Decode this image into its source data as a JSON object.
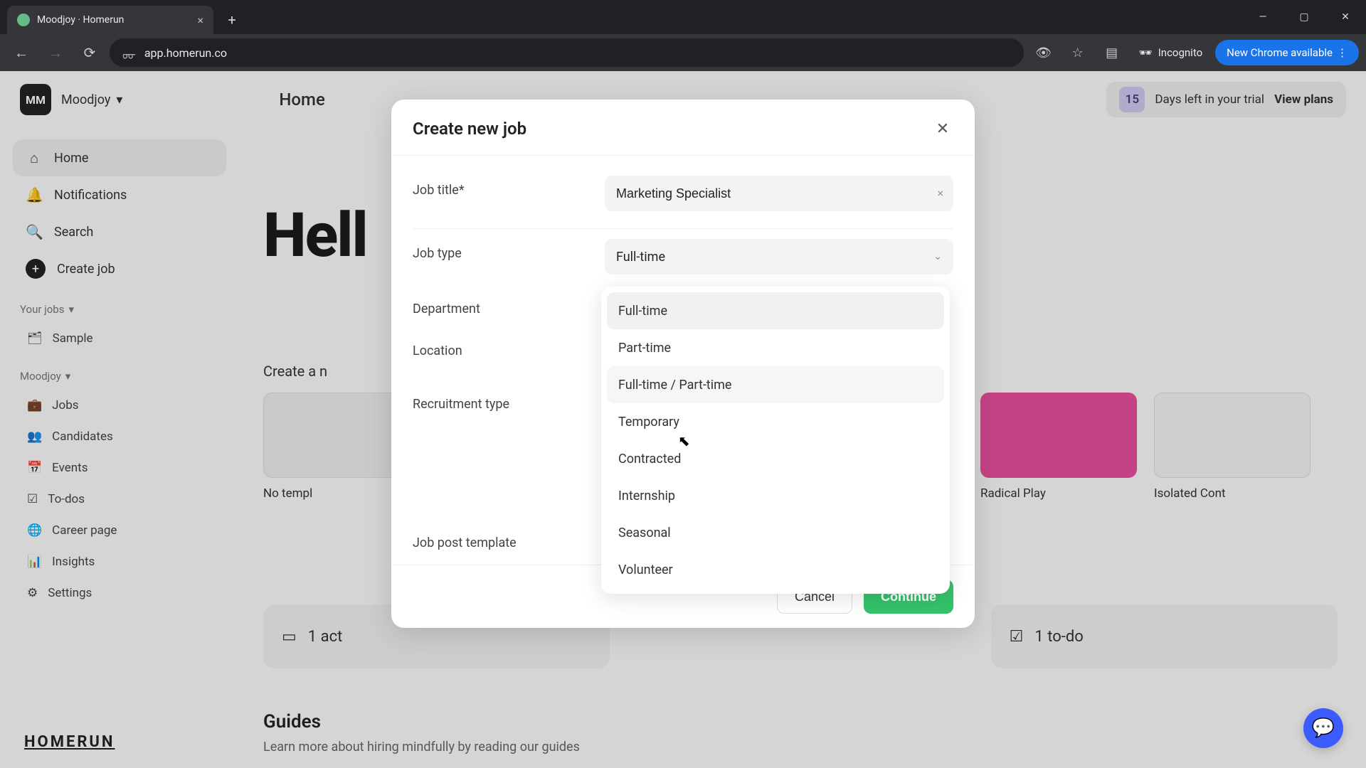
{
  "browser": {
    "tab_title": "Moodjoy · Homerun",
    "url": "app.homerun.co",
    "incognito_label": "Incognito",
    "update_label": "New Chrome available"
  },
  "app": {
    "org_initials": "MM",
    "org_name": "Moodjoy",
    "page_title": "Home",
    "trial_days": "15",
    "trial_text": "Days left in your trial",
    "trial_cta": "View plans"
  },
  "sidebar": {
    "items": [
      {
        "label": "Home"
      },
      {
        "label": "Notifications"
      },
      {
        "label": "Search"
      },
      {
        "label": "Create job"
      }
    ],
    "section1": "Your jobs",
    "sample": "Sample",
    "section2": "Moodjoy",
    "items2": [
      {
        "label": "Jobs"
      },
      {
        "label": "Candidates"
      },
      {
        "label": "Events"
      },
      {
        "label": "To-dos"
      },
      {
        "label": "Career page"
      },
      {
        "label": "Insights"
      },
      {
        "label": "Settings"
      }
    ]
  },
  "main": {
    "greeting": "Hell",
    "strip_label": "Create a n",
    "no_tmpl": "No templ",
    "templates": [
      {
        "label": "",
        "color": "#111"
      },
      {
        "label": "Radical Play",
        "color": "#e84f9c"
      },
      {
        "label": "Isolated Cont",
        "color": "#f4f4f4"
      }
    ],
    "stats": [
      {
        "label": "1 act"
      },
      {
        "label": "1 to-do"
      }
    ],
    "guides_title": "Guides",
    "guides_sub": "Learn more about hiring mindfully by reading our guides"
  },
  "brand": "HOMERUN",
  "modal": {
    "title": "Create new job",
    "labels": {
      "job_title": "Job title*",
      "job_type": "Job type",
      "department": "Department",
      "location": "Location",
      "recruitment_type": "Recruitment type",
      "job_post_template": "Job post template"
    },
    "job_title_value": "Marketing Specialist",
    "job_type_value": "Full-time",
    "job_type_options": [
      "Full-time",
      "Part-time",
      "Full-time / Part-time",
      "Temporary",
      "Contracted",
      "Internship",
      "Seasonal",
      "Volunteer"
    ],
    "cancel": "Cancel",
    "continue": "Continue"
  }
}
